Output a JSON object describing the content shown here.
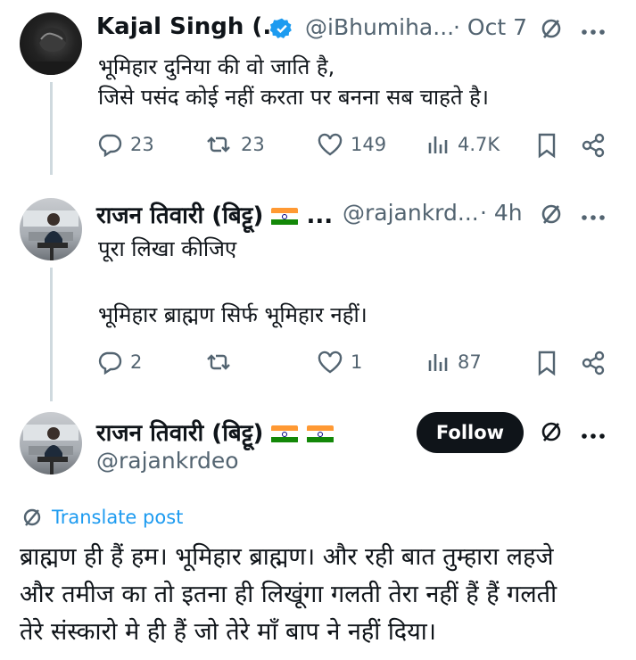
{
  "colors": {
    "accent": "#1d9bf0",
    "secondary_text": "#536471",
    "primary_text": "#0f1419",
    "follow_bg": "#0f1419"
  },
  "tweet1": {
    "name": "Kajal Singh (...",
    "handle": "@iBhumiha...",
    "date": "· Oct 7",
    "verified": true,
    "lines": [
      "भूमिहार दुनिया की वो जाति है,",
      "जिसे पसंद कोई नहीं करता पर बनना सब चाहते है।"
    ],
    "stats": {
      "replies": "23",
      "reposts": "23",
      "likes": "149",
      "views": "4.7K"
    }
  },
  "tweet2": {
    "name": "राजन तिवारी (बिट्टू)",
    "name_suffix": "...",
    "handle": "@rajankrd...",
    "date": "· 4h",
    "lines": [
      "पूरा लिखा कीजिए",
      "भूमिहार ब्राह्मण सिर्फ भूमिहार नहीं।"
    ],
    "stats": {
      "replies": "2",
      "reposts": "",
      "likes": "1",
      "views": "87"
    }
  },
  "main_tweet": {
    "name": "राजन तिवारी (बिट्टू)",
    "handle": "@rajankrdeo",
    "follow_label": "Follow",
    "translate_label": "Translate post",
    "lines": [
      "ब्राह्मण ही हैं हम। भूमिहार ब्राह्मण।  और रही बात तुम्हारा लहजे",
      "और तमीज का तो इतना ही लिखूंगा गलती तेरा नहीं हैं हैं गलती",
      "तेरे संस्कारो मे ही हैं जो तेरे माँ बाप ने नहीं दिया।"
    ]
  },
  "icons": [
    "reply-icon",
    "repost-icon",
    "like-icon",
    "views-icon",
    "bookmark-icon",
    "share-icon",
    "grok-icon",
    "more-icon",
    "verified-icon",
    "flag-india-icon"
  ]
}
